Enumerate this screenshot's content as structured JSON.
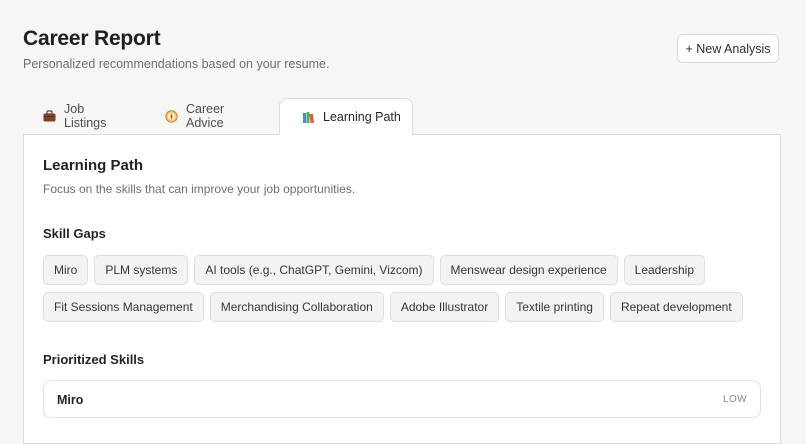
{
  "header": {
    "title": "Career Report",
    "subtitle": "Personalized recommendations based on your resume.",
    "new_analysis_label": "+ New Analysis"
  },
  "tabs": [
    {
      "label": "Job Listings",
      "icon": "briefcase-icon"
    },
    {
      "label": "Career Advice",
      "icon": "compass-icon"
    },
    {
      "label": "Learning Path",
      "icon": "books-icon",
      "active": true
    }
  ],
  "learning_path": {
    "title": "Learning Path",
    "subtitle": "Focus on the skills that can improve your job opportunities.",
    "skill_gaps_heading": "Skill Gaps",
    "skill_gaps": [
      [
        "Miro",
        "PLM systems",
        "AI tools (e.g., ChatGPT, Gemini, Vizcom)",
        "Menswear design experience",
        "Leadership"
      ],
      [
        "Fit Sessions Management",
        "Merchandising Collaboration",
        "Adobe Illustrator",
        "Textile printing",
        "Repeat development"
      ]
    ],
    "prioritized_heading": "Prioritized Skills",
    "prioritized_skills": [
      {
        "name": "Miro",
        "priority": "LOW"
      }
    ]
  },
  "colors": {
    "background": "#f6f6f4",
    "panel": "#ffffff",
    "chip_bg": "#f3f3f1",
    "border": "#dcdcd8"
  }
}
